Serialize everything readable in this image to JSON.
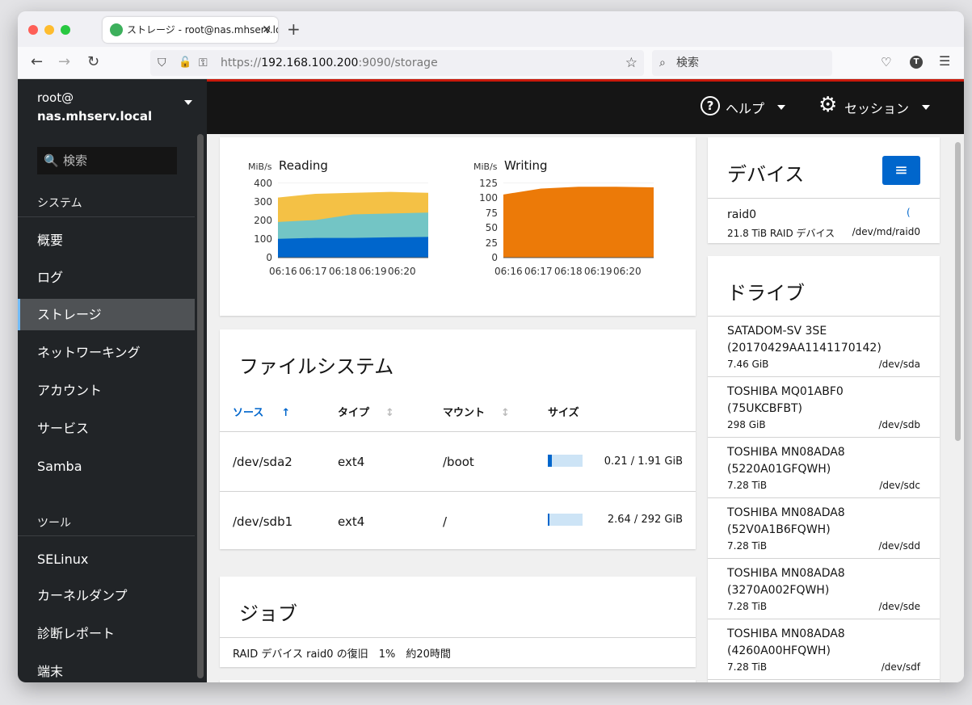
{
  "browser": {
    "tab_title": "ストレージ - root@nas.mhserv.lo",
    "url_prefix": "https://",
    "url_host": "192.168.100.200",
    "url_rest": ":9090/storage",
    "search_placeholder": "検索"
  },
  "sidebar": {
    "user": "root@",
    "host": "nas.mhserv.local",
    "search_placeholder": "検索",
    "section_system": "システム",
    "system_items": [
      "概要",
      "ログ",
      "ストレージ",
      "ネットワーキング",
      "アカウント",
      "サービス",
      "Samba"
    ],
    "section_tools": "ツール",
    "tool_items": [
      "SELinux",
      "カーネルダンプ",
      "診断レポート",
      "端末"
    ]
  },
  "topbar": {
    "help_label": "ヘルプ",
    "session_label": "セッション"
  },
  "charts": {
    "reading": {
      "title": "Reading",
      "unit": "MiB/s",
      "yticks": [
        "400",
        "300",
        "200",
        "100",
        "0"
      ],
      "xticks": [
        "06:16",
        "06:17",
        "06:18",
        "06:19",
        "06:20"
      ]
    },
    "writing": {
      "title": "Writing",
      "unit": "MiB/s",
      "yticks": [
        "125",
        "100",
        "75",
        "50",
        "25",
        "0"
      ],
      "xticks": [
        "06:16",
        "06:17",
        "06:18",
        "06:19",
        "06:20"
      ]
    }
  },
  "chart_data": [
    {
      "type": "area",
      "title": "Reading",
      "ylabel": "MiB/s",
      "x": [
        "06:16",
        "06:17",
        "06:18",
        "06:19",
        "06:20"
      ],
      "ylim": [
        0,
        400
      ],
      "series": [
        {
          "values": [
            100,
            105,
            105,
            108,
            110
          ]
        },
        {
          "values": [
            190,
            200,
            230,
            235,
            240
          ]
        },
        {
          "values": [
            320,
            340,
            345,
            350,
            345
          ]
        }
      ]
    },
    {
      "type": "area",
      "title": "Writing",
      "ylabel": "MiB/s",
      "x": [
        "06:16",
        "06:17",
        "06:18",
        "06:19",
        "06:20"
      ],
      "ylim": [
        0,
        125
      ],
      "series": [
        {
          "values": [
            105,
            115,
            118,
            118,
            117
          ]
        }
      ]
    }
  ],
  "filesystems": {
    "title": "ファイルシステム",
    "headers": {
      "source": "ソース",
      "type": "タイプ",
      "mount": "マウント",
      "size": "サイズ"
    },
    "rows": [
      {
        "source": "/dev/sda2",
        "type": "ext4",
        "mount": "/boot",
        "size": "0.21 / 1.91 GiB",
        "usage": 0.11
      },
      {
        "source": "/dev/sdb1",
        "type": "ext4",
        "mount": "/",
        "size": "2.64 / 292 GiB",
        "usage": 0.01
      }
    ]
  },
  "jobs": {
    "title": "ジョブ",
    "text": "RAID デバイス raid0 の復旧　1%　約20時間"
  },
  "devices": {
    "title": "デバイス",
    "items": [
      {
        "name": "raid0",
        "desc": "21.8 TiB RAID デバイス",
        "path": "/dev/md/raid0"
      }
    ]
  },
  "drives": {
    "title": "ドライブ",
    "items": [
      {
        "model": "SATADOM-SV 3SE",
        "serial": "(20170429AA1141170142)",
        "size": "7.46 GiB",
        "path": "/dev/sda"
      },
      {
        "model": "TOSHIBA MQ01ABF0",
        "serial": "(75UKCBFBT)",
        "size": "298 GiB",
        "path": "/dev/sdb"
      },
      {
        "model": "TOSHIBA MN08ADA8",
        "serial": "(5220A01GFQWH)",
        "size": "7.28 TiB",
        "path": "/dev/sdc"
      },
      {
        "model": "TOSHIBA MN08ADA8",
        "serial": "(52V0A1B6FQWH)",
        "size": "7.28 TiB",
        "path": "/dev/sdd"
      },
      {
        "model": "TOSHIBA MN08ADA8",
        "serial": "(3270A002FQWH)",
        "size": "7.28 TiB",
        "path": "/dev/sde"
      },
      {
        "model": "TOSHIBA MN08ADA8",
        "serial": "(4260A00HFQWH)",
        "size": "7.28 TiB",
        "path": "/dev/sdf"
      }
    ]
  },
  "colors": {
    "accent": "#0066cc",
    "read_low": "#0066cc",
    "read_mid": "#73c5c5",
    "read_high": "#f4c145",
    "write": "#ec7a08",
    "topbar": "#151515",
    "sidebar": "#212427"
  }
}
